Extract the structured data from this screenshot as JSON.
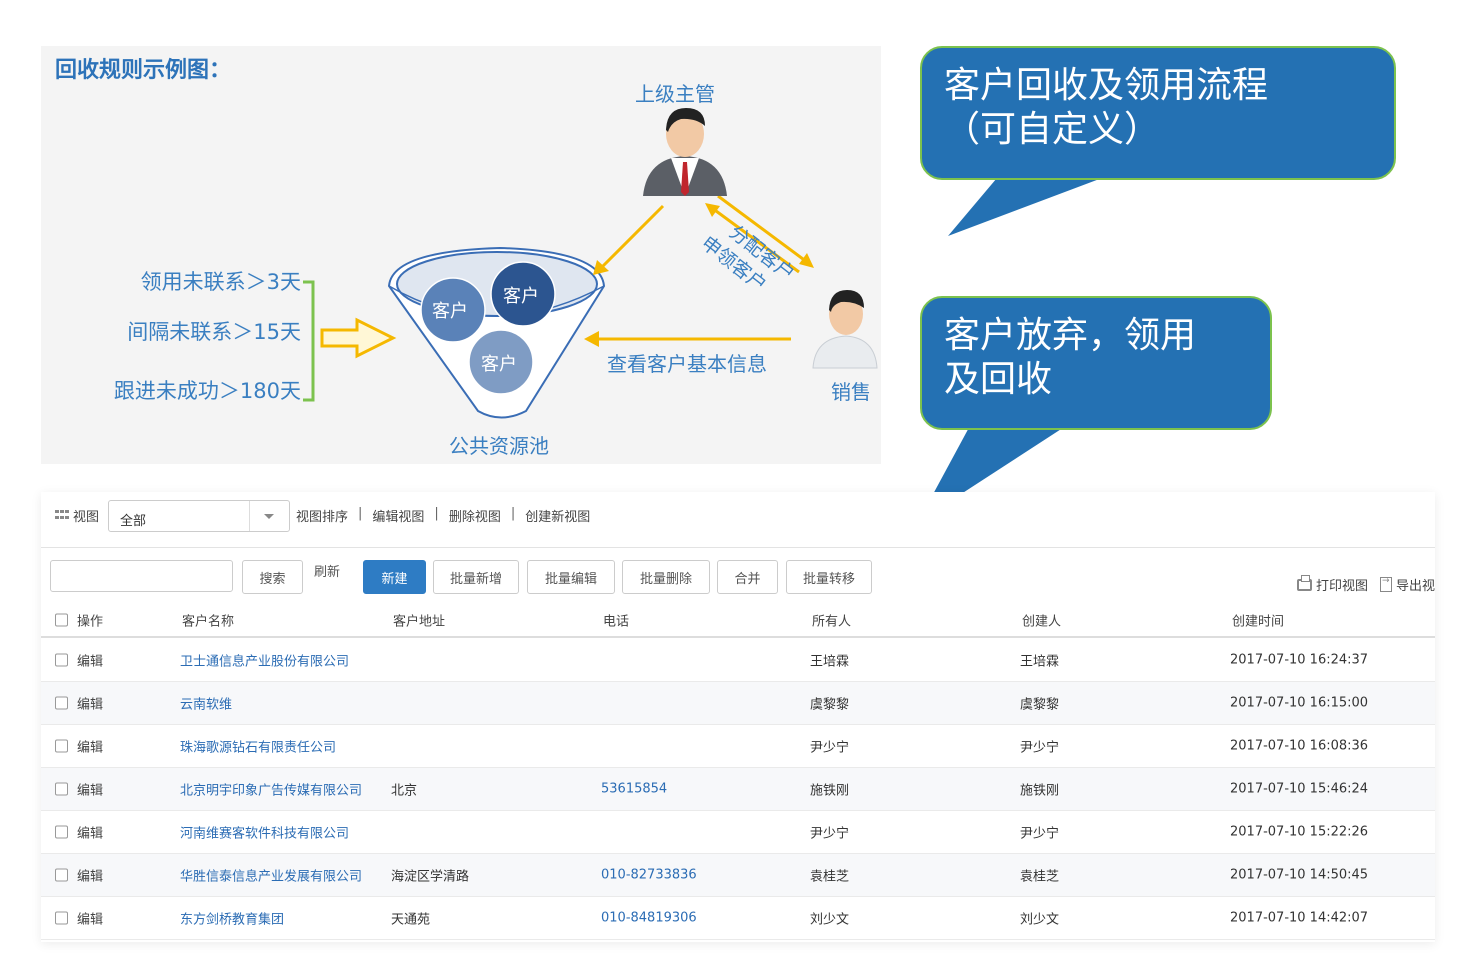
{
  "diagram": {
    "title": "回收规则示例图：",
    "supervisor_label": "上级主管",
    "sales_label": "销售",
    "pool_label": "公共资源池",
    "assign_label": "分配客户",
    "apply_label": "申领客户",
    "view_info_label": "查看客户基本信息",
    "customer_ball_label": "客户",
    "rules": [
      "领用未联系＞3天",
      "间隔未联系＞15天",
      "跟进未成功＞180天"
    ],
    "colors": {
      "arrow": "#f5b800",
      "text": "#3a7fc1",
      "bracket": "#7cc24e"
    }
  },
  "callouts": {
    "flow": [
      "客户回收及领用流程",
      "（可自定义）"
    ],
    "abandon": [
      "客户放弃，领用",
      "及回收"
    ]
  },
  "viewbar": {
    "view_label": "视图",
    "select_value": "全部",
    "links": [
      "视图排序",
      "编辑视图",
      "删除视图",
      "创建新视图"
    ]
  },
  "toolbar": {
    "search_placeholder": "",
    "search_button": "搜索",
    "refresh": "刷新",
    "new": "新建",
    "batch_add": "批量新增",
    "batch_edit": "批量编辑",
    "batch_delete": "批量删除",
    "merge": "合并",
    "batch_transfer": "批量转移",
    "print_view": "打印视图",
    "export_view": "导出视"
  },
  "table": {
    "headers": [
      "操作",
      "客户名称",
      "客户地址",
      "电话",
      "所有人",
      "创建人",
      "创建时间"
    ],
    "rows": [
      {
        "action": "编辑",
        "name": "卫士通信息产业股份有限公司",
        "address": "",
        "phone": "",
        "owner": "王培霖",
        "creator": "王培霖",
        "created": "2017-07-10 16:24:37"
      },
      {
        "action": "编辑",
        "name": "云南软维",
        "address": "",
        "phone": "",
        "owner": "虞黎黎",
        "creator": "虞黎黎",
        "created": "2017-07-10 16:15:00"
      },
      {
        "action": "编辑",
        "name": "珠海歌源钻石有限责任公司",
        "address": "",
        "phone": "",
        "owner": "尹少宁",
        "creator": "尹少宁",
        "created": "2017-07-10 16:08:36"
      },
      {
        "action": "编辑",
        "name": "北京明宇印象广告传媒有限公司",
        "address": "北京",
        "phone": "53615854",
        "owner": "施铁刚",
        "creator": "施铁刚",
        "created": "2017-07-10 15:46:24"
      },
      {
        "action": "编辑",
        "name": "河南维赛客软件科技有限公司",
        "address": "",
        "phone": "",
        "owner": "尹少宁",
        "creator": "尹少宁",
        "created": "2017-07-10 15:22:26"
      },
      {
        "action": "编辑",
        "name": "华胜信泰信息产业发展有限公司",
        "address": "海淀区学清路",
        "phone": "010-82733836",
        "owner": "袁桂芝",
        "creator": "袁桂芝",
        "created": "2017-07-10 14:50:45"
      },
      {
        "action": "编辑",
        "name": "东方剑桥教育集团",
        "address": "天通苑",
        "phone": "010-84819306",
        "owner": "刘少文",
        "creator": "刘少文",
        "created": "2017-07-10 14:42:07"
      }
    ]
  }
}
